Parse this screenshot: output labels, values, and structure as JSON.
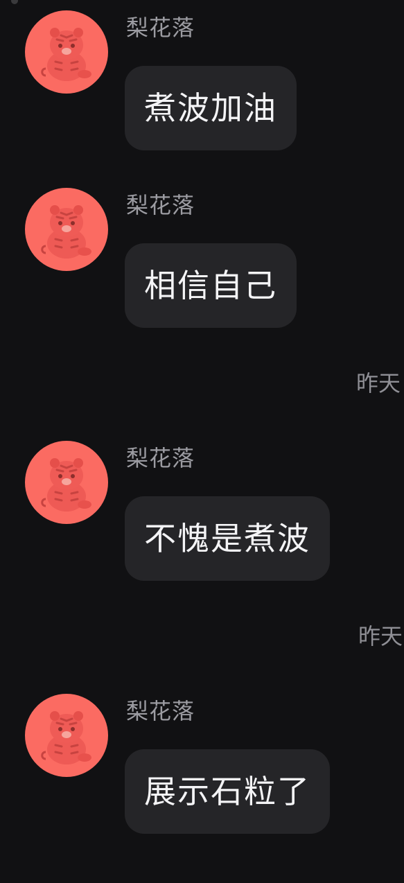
{
  "colors": {
    "background": "#111113",
    "bubble": "#252528",
    "avatar": "#fb6b62",
    "sender_text": "#9c9ca2",
    "message_text": "#f4f4f6",
    "timestamp_text": "#8f8f95"
  },
  "messages": [
    {
      "sender": "梨花落",
      "avatar_icon": "tiger-avatar-icon",
      "text": "煮波加油"
    },
    {
      "sender": "梨花落",
      "avatar_icon": "tiger-avatar-icon",
      "text": "相信自己"
    },
    {
      "sender": "梨花落",
      "avatar_icon": "tiger-avatar-icon",
      "text": "不愧是煮波"
    },
    {
      "sender": "梨花落",
      "avatar_icon": "tiger-avatar-icon",
      "text": "展示石粒了"
    }
  ],
  "timestamps": [
    "昨天",
    "昨天"
  ]
}
